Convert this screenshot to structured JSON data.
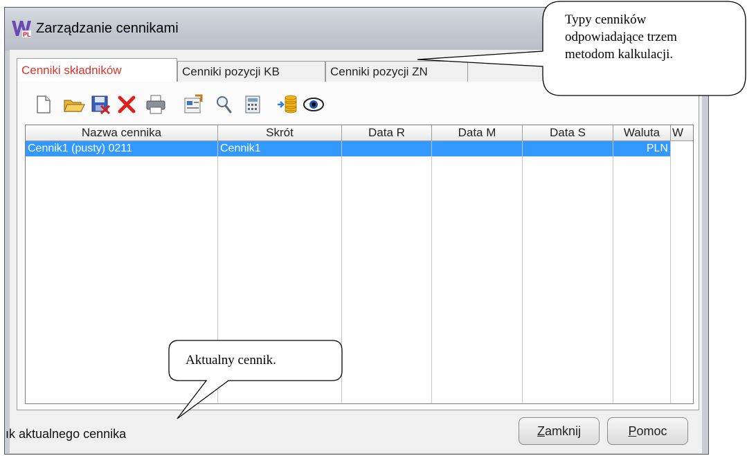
{
  "window": {
    "title": "Zarządzanie cennikami",
    "logo_icon": "wplus-logo-icon"
  },
  "tabs": [
    {
      "label": "Cenniki składników",
      "active": true
    },
    {
      "label": "Cenniki pozycji KB",
      "active": false
    },
    {
      "label": "Cenniki pozycji ZN",
      "active": false
    }
  ],
  "toolbar": {
    "icons": [
      "new-document-icon",
      "open-folder-icon",
      "save-icon",
      "delete-icon",
      "print-icon",
      "properties-icon",
      "search-icon",
      "calculator-icon",
      "import-icon",
      "preview-eye-icon"
    ]
  },
  "table": {
    "columns": [
      "Nazwa cennika",
      "Skrót",
      "Data R",
      "Data M",
      "Data S",
      "Waluta",
      "W"
    ],
    "rows": [
      {
        "nazwa": "Cennik1 (pusty) 0211",
        "skrot": "Cennik1",
        "data_r": "",
        "data_m": "",
        "data_s": "",
        "waluta": "PLN",
        "w": "",
        "selected": true
      }
    ]
  },
  "status": {
    "text": "ık aktualnego cennika"
  },
  "buttons": {
    "close": {
      "underline": "Z",
      "rest": "amknij"
    },
    "help": {
      "underline": "P",
      "rest": "omoc"
    }
  },
  "callouts": {
    "tabs_note": [
      "Typy cenników",
      "odpowiadające trzem",
      "metodom kalkulacji."
    ],
    "current_note": "Aktualny cennik."
  },
  "colors": {
    "selection": "#3399ff",
    "active_tab_text": "#e0302a"
  }
}
